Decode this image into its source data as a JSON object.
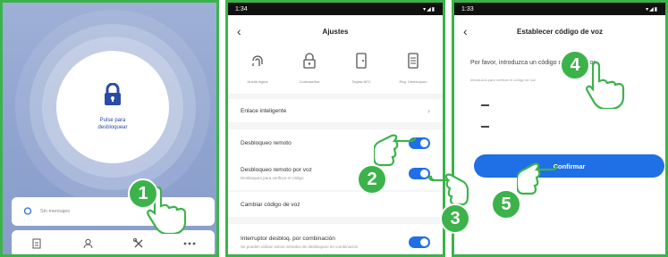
{
  "colors": {
    "border_green": "#3cb34a",
    "accent_blue": "#1f6fe6",
    "screen1_bg": "#8ea2cf"
  },
  "screen1": {
    "unlock_label": "Pulse para\ndesbloquear",
    "message_text": "Sin mensajes",
    "icons": [
      "lock-icon",
      "bell-icon",
      "note-icon",
      "person-icon",
      "tools-icon",
      "more-icon"
    ]
  },
  "screen2": {
    "status_time": "1:34",
    "status_icons": "▾◢▮",
    "title": "Ajustes",
    "shortcuts": [
      {
        "icon": "fingerprint-icon",
        "label": "Huella digital"
      },
      {
        "icon": "password-lock-icon",
        "label": "Contraseñas"
      },
      {
        "icon": "card-icon",
        "label": "Tarjeta NFC"
      },
      {
        "icon": "record-icon",
        "label": "Reg. Desbloqueo"
      }
    ],
    "smart_link": "Enlace inteligente",
    "remote_unlock": "Desbloqueo remoto",
    "voice_unlock": "Desbloqueo remoto por voz",
    "voice_unlock_sub": "Desbloqueo para verificar el código",
    "change_code": "Cambiar código de voz",
    "combo_switch": "Interruptor desbloq. por combinación",
    "combo_sub": "Se pueden utilizar varios métodos de desbloqueo en combinación"
  },
  "screen3": {
    "status_time": "1:33",
    "status_icons": "▾◢▮",
    "title": "Establecer código de voz",
    "prompt": "Por favor, introduzca un código de 4-6 dígitos",
    "hint": "Introduzca para verificar el código de voz",
    "confirm_label": "Confirmar"
  },
  "callouts": [
    "1",
    "2",
    "3",
    "4",
    "5"
  ]
}
